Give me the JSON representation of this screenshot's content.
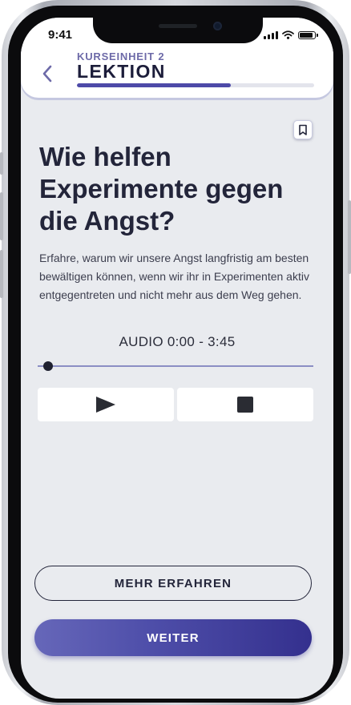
{
  "status_bar": {
    "time": "9:41"
  },
  "header": {
    "kicker": "KURSEINHEIT 2",
    "title": "LEKTION",
    "progress": 0.65
  },
  "lesson": {
    "heading": "Wie helfen Experimente gegen die Angst?",
    "description": "Erfahre, warum wir unsere Angst langfristig am besten bewältigen können, wenn wir ihr in Experimenten aktiv entgegentreten und nicht mehr aus dem Weg gehen."
  },
  "audio": {
    "label": "AUDIO 0:00 - 3:45",
    "position": 0.0
  },
  "buttons": {
    "more": "MEHR ERFAHREN",
    "next": "WEITER"
  },
  "icons": {
    "back": "chevron-left-icon",
    "bookmark": "bookmark-icon",
    "play": "play-icon",
    "stop": "stop-icon",
    "signal": "signal-icon",
    "wifi": "wifi-icon",
    "battery": "battery-icon"
  },
  "colors": {
    "accent": "#4d4aa8",
    "kicker": "#6d6aa8",
    "text": "#23253a",
    "background": "#e9ebef",
    "primary_gradient_start": "#6667b9",
    "primary_gradient_end": "#34308e"
  }
}
